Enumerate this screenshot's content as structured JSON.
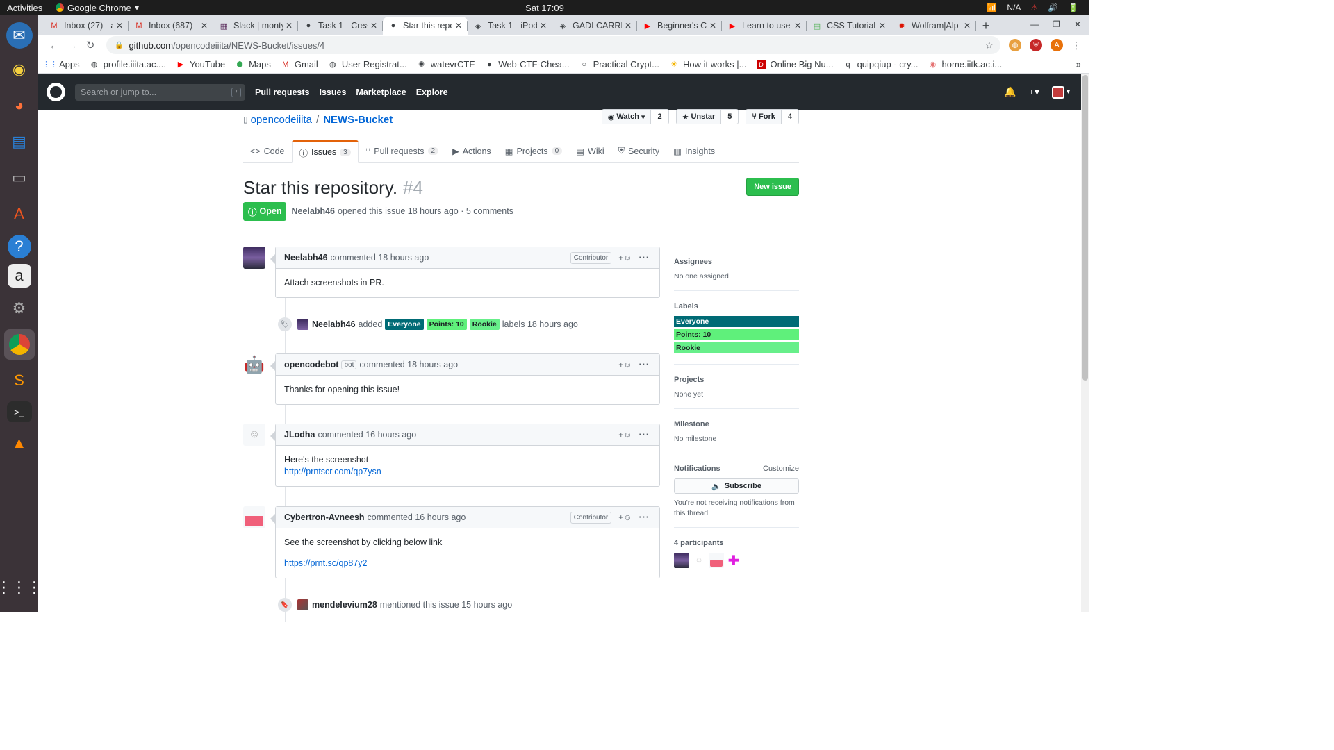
{
  "system": {
    "activities": "Activities",
    "app_name": "Google Chrome",
    "clock": "Sat 17:09",
    "tray": [
      "N/A",
      "⚠",
      "🔊",
      "🔋"
    ]
  },
  "dock": [
    "thunderbird-icon",
    "rhythmbox-icon",
    "firefox-icon",
    "writer-icon",
    "files-icon",
    "software-icon",
    "help-icon",
    "amazon-icon",
    "settings-icon",
    "chrome-icon",
    "sublime-icon",
    "terminal-icon",
    "vlc-icon"
  ],
  "tabs": [
    {
      "label": "Inbox (27) - a",
      "icon": "M",
      "color": "#d93025"
    },
    {
      "label": "Inbox (687) -",
      "icon": "M",
      "color": "#d93025"
    },
    {
      "label": "Slack | monty",
      "icon": "▦",
      "color": "#4a154b"
    },
    {
      "label": "Task 1 - Crea",
      "icon": "●",
      "color": "#24292e"
    },
    {
      "label": "Star this repo",
      "icon": "●",
      "color": "#24292e",
      "active": true
    },
    {
      "label": "Task 1 - iPod",
      "icon": "◈",
      "color": "#24292e"
    },
    {
      "label": "GADI CARRR",
      "icon": "◈",
      "color": "#24292e"
    },
    {
      "label": "Beginner's C",
      "icon": "▶",
      "color": "#ff0000"
    },
    {
      "label": "Learn to use",
      "icon": "▶",
      "color": "#ff0000"
    },
    {
      "label": "CSS Tutorial",
      "icon": "▤",
      "color": "#4caf50"
    },
    {
      "label": "Wolfram|Alp",
      "icon": "✹",
      "color": "#dd1100"
    }
  ],
  "url": {
    "host": "github.com",
    "path": "/opencodeiiita/NEWS-Bucket/issues/4"
  },
  "bookmarks": [
    {
      "label": "Apps",
      "icon": "⋮⋮",
      "color": "#4285f4"
    },
    {
      "label": "profile.iiita.ac....",
      "icon": "◍",
      "color": "#5f6368"
    },
    {
      "label": "YouTube",
      "icon": "▶",
      "color": "#ff0000"
    },
    {
      "label": "Maps",
      "icon": "⬢",
      "color": "#34a853"
    },
    {
      "label": "Gmail",
      "icon": "M",
      "color": "#d93025"
    },
    {
      "label": "User Registrat...",
      "icon": "◍",
      "color": "#5f6368"
    },
    {
      "label": "watevrCTF",
      "icon": "✺",
      "color": "#555"
    },
    {
      "label": "Web-CTF-Chea...",
      "icon": "●",
      "color": "#24292e"
    },
    {
      "label": "Practical Crypt...",
      "icon": "○",
      "color": "#5f6368"
    },
    {
      "label": "How it works |...",
      "icon": "☀",
      "color": "#f4b400"
    },
    {
      "label": "Online Big Nu...",
      "icon": "D",
      "color": "#c00"
    },
    {
      "label": "quipqiup - cry...",
      "icon": "q",
      "color": "#5f6368"
    },
    {
      "label": "home.iitk.ac.i...",
      "icon": "◉",
      "color": "#e57373"
    }
  ],
  "github": {
    "search_placeholder": "Search or jump to...",
    "search_key": "/",
    "nav": [
      "Pull requests",
      "Issues",
      "Marketplace",
      "Explore"
    ]
  },
  "repo": {
    "owner": "opencodeiiita",
    "name": "NEWS-Bucket",
    "watch": {
      "label": "Watch",
      "count": "2"
    },
    "star": {
      "label": "Unstar",
      "count": "5"
    },
    "fork": {
      "label": "Fork",
      "count": "4"
    },
    "tabs": [
      {
        "label": "Code",
        "icon": "<>",
        "count": ""
      },
      {
        "label": "Issues",
        "icon": "ⓘ",
        "count": "3",
        "active": true
      },
      {
        "label": "Pull requests",
        "icon": "⑂",
        "count": "2"
      },
      {
        "label": "Actions",
        "icon": "▶",
        "count": ""
      },
      {
        "label": "Projects",
        "icon": "▦",
        "count": "0"
      },
      {
        "label": "Wiki",
        "icon": "▤",
        "count": ""
      },
      {
        "label": "Security",
        "icon": "⛨",
        "count": ""
      },
      {
        "label": "Insights",
        "icon": "▥",
        "count": ""
      }
    ]
  },
  "issue": {
    "title": "Star this repository.",
    "number": "#4",
    "new_issue": "New issue",
    "state": "Open",
    "author": "Neelabh46",
    "meta": "opened this issue 18 hours ago · 5 comments"
  },
  "timeline": {
    "c1": {
      "author": "Neelabh46",
      "time": "commented 18 hours ago",
      "role": "Contributor",
      "body": "Attach screenshots in PR."
    },
    "e1": {
      "who": "Neelabh46",
      "action": "added",
      "labels": [
        "Everyone",
        "Points: 10",
        "Rookie"
      ],
      "suffix": "labels 18 hours ago"
    },
    "c2": {
      "author": "opencodebot",
      "bot": "bot",
      "time": "commented 18 hours ago",
      "body": "Thanks for opening this issue!"
    },
    "c3": {
      "author": "JLodha",
      "time": "commented 16 hours ago",
      "body": "Here's the screenshot",
      "link": "http://prntscr.com/qp7ysn"
    },
    "c4": {
      "author": "Cybertron-Avneesh",
      "time": "commented 16 hours ago",
      "role": "Contributor",
      "body": "See the screenshot by clicking below link",
      "link": "https://prnt.sc/qp87y2"
    },
    "e2": {
      "who": "mendelevium28",
      "action": "mentioned this issue 15 hours ago"
    }
  },
  "sidebar": {
    "assignees_h": "Assignees",
    "assignees_v": "No one assigned",
    "labels_h": "Labels",
    "labels": [
      {
        "name": "Everyone",
        "bg": "#006b75",
        "fg": "#ffffff"
      },
      {
        "name": "Points: 10",
        "bg": "#5ff07b",
        "fg": "#1b1f23"
      },
      {
        "name": "Rookie",
        "bg": "#67ef8a",
        "fg": "#1b1f23"
      }
    ],
    "projects_h": "Projects",
    "projects_v": "None yet",
    "milestone_h": "Milestone",
    "milestone_v": "No milestone",
    "notifications_h": "Notifications",
    "customize": "Customize",
    "subscribe": "Subscribe",
    "notif_note": "You're not receiving notifications from this thread.",
    "participants_h": "4 participants"
  }
}
